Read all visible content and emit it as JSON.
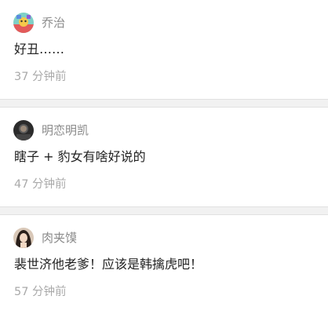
{
  "comments": [
    {
      "username": "乔治",
      "avatar_icon": "cartoon-avatar-icon",
      "content": "好丑……",
      "time": "37 分钟前"
    },
    {
      "username": "明恋明凯",
      "avatar_icon": "dark-portrait-avatar-icon",
      "content": "瞎子 + 豹女有啥好说的",
      "time": "47 分钟前"
    },
    {
      "username": "肉夹馍",
      "avatar_icon": "woman-portrait-avatar-icon",
      "content": "裴世济他老爹！应该是韩擒虎吧！",
      "time": "57 分钟前"
    }
  ],
  "colors": {
    "username": "#8a8a8a",
    "content": "#222222",
    "time": "#aaaaaa",
    "separator": "#f1f1f1"
  }
}
